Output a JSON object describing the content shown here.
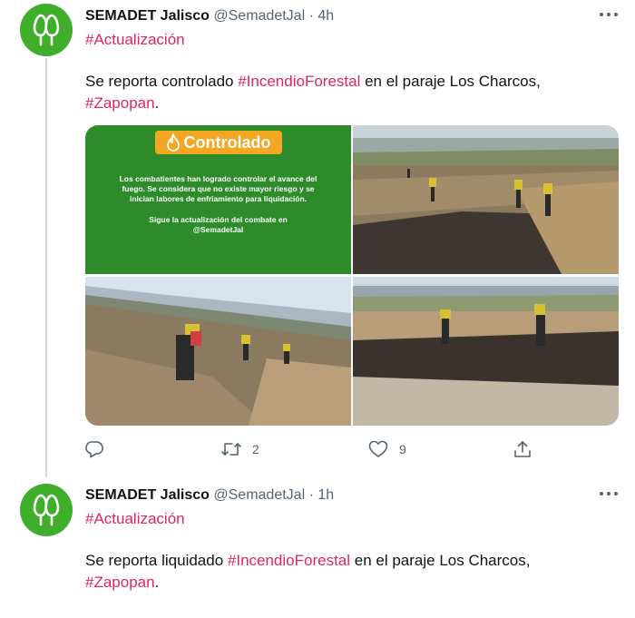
{
  "tweets": [
    {
      "author_name": "SEMADET Jalisco",
      "handle": "@SemadetJal",
      "separator": "·",
      "time": "4h",
      "hashtag_line": "#Actualización",
      "text_before": "Se reporta controlado ",
      "tag_1": "#IncendioForestal",
      "text_middle": " en el paraje Los Charcos,",
      "tag_2": "#Zapopan",
      "text_after": ".",
      "media_card": {
        "badge": "Controlado",
        "body": "Los combatientes han logrado controlar el avance del fuego. Se considera que no existe mayor riesgo y se inician labores de enfriamiento para liquidación.",
        "follow": "Sigue la actualización del combate en @SemadetJal"
      },
      "stats": {
        "replies": "",
        "retweets": "2",
        "likes": "9"
      }
    },
    {
      "author_name": "SEMADET Jalisco",
      "handle": "@SemadetJal",
      "separator": "·",
      "time": "1h",
      "hashtag_line": "#Actualización",
      "text_before": "Se reporta liquidado ",
      "tag_1": "#IncendioForestal",
      "text_middle": " en el paraje Los Charcos,",
      "tag_2": "#Zapopan",
      "text_after": "."
    }
  ],
  "icons": {
    "avatar": "tree-logo-icon",
    "more": "more-dots-icon",
    "reply": "reply-bubble-icon",
    "retweet": "retweet-icon",
    "like": "heart-icon",
    "share": "share-icon",
    "badge": "flame-icon"
  },
  "colors": {
    "hashtag": "#e0245e",
    "avatar_bg": "#3fae2a",
    "card_bg": "#2e8b2a",
    "badge_bg": "#f5a623",
    "muted": "#536471"
  }
}
